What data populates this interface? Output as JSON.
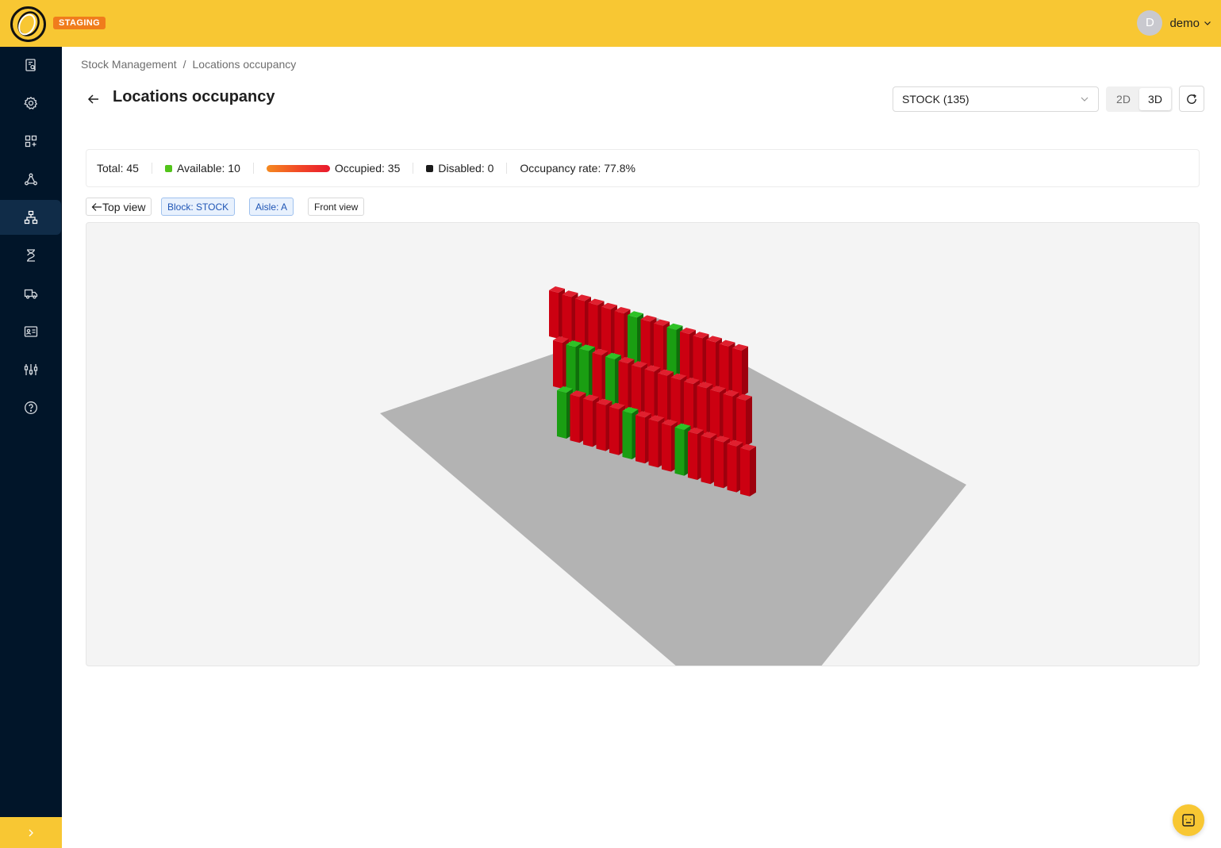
{
  "app": {
    "environment_badge": "STAGING",
    "brand_color": "#f8c733",
    "sidebar_color": "#011529"
  },
  "user": {
    "initial": "D",
    "name": "demo"
  },
  "sidebar": {
    "items": [
      {
        "icon": "clipboard-search-icon",
        "active": false
      },
      {
        "icon": "gear-icon",
        "active": false
      },
      {
        "icon": "grid-plus-icon",
        "active": false
      },
      {
        "icon": "network-icon",
        "active": false
      },
      {
        "icon": "hierarchy-icon",
        "active": true
      },
      {
        "icon": "hourglass-icon",
        "active": false
      },
      {
        "icon": "truck-icon",
        "active": false
      },
      {
        "icon": "id-card-icon",
        "active": false
      },
      {
        "icon": "sliders-icon",
        "active": false
      },
      {
        "icon": "help-circle-icon",
        "active": false
      }
    ],
    "expand_icon": "chevron-right-icon"
  },
  "breadcrumb": {
    "parent": "Stock Management",
    "separator": "/",
    "current": "Locations occupancy"
  },
  "header": {
    "title": "Locations occupancy",
    "warehouse_select": "STOCK (135)",
    "view_modes": [
      "2D",
      "3D"
    ],
    "selected_view_mode": "3D"
  },
  "stats": {
    "total": "Total: 45",
    "available": "Available: 10",
    "occupied": "Occupied: 35",
    "disabled": "Disabled: 0",
    "occupancy_rate": "Occupancy rate: 77.8%",
    "available_color": "#52c41a",
    "disabled_color": "#1a1a1a",
    "occupied_gradient": [
      "#f58a20",
      "#e8192e"
    ]
  },
  "view_controls": {
    "top_view": "Top view",
    "block_tag": "Block: STOCK",
    "aisle_tag": "Aisle: A",
    "front_view": "Front view"
  },
  "scene": {
    "floor_color": "#b3b3b3",
    "occupied_color": "#cc0011",
    "available_color": "#1a9e12",
    "levels": [
      {
        "name": "top",
        "cells": [
          "occupied",
          "occupied",
          "occupied",
          "occupied",
          "occupied",
          "occupied",
          "available",
          "occupied",
          "occupied",
          "available",
          "occupied",
          "occupied",
          "occupied",
          "occupied",
          "occupied"
        ]
      },
      {
        "name": "middle",
        "cells": [
          "occupied",
          "available",
          "available",
          "occupied",
          "available",
          "occupied",
          "occupied",
          "occupied",
          "occupied",
          "occupied",
          "occupied",
          "occupied",
          "occupied",
          "occupied",
          "occupied"
        ]
      },
      {
        "name": "bottom",
        "cells": [
          "available",
          "occupied",
          "occupied",
          "occupied",
          "occupied",
          "available",
          "occupied",
          "occupied",
          "occupied",
          "available",
          "occupied",
          "occupied",
          "occupied",
          "occupied",
          "occupied"
        ]
      }
    ]
  }
}
